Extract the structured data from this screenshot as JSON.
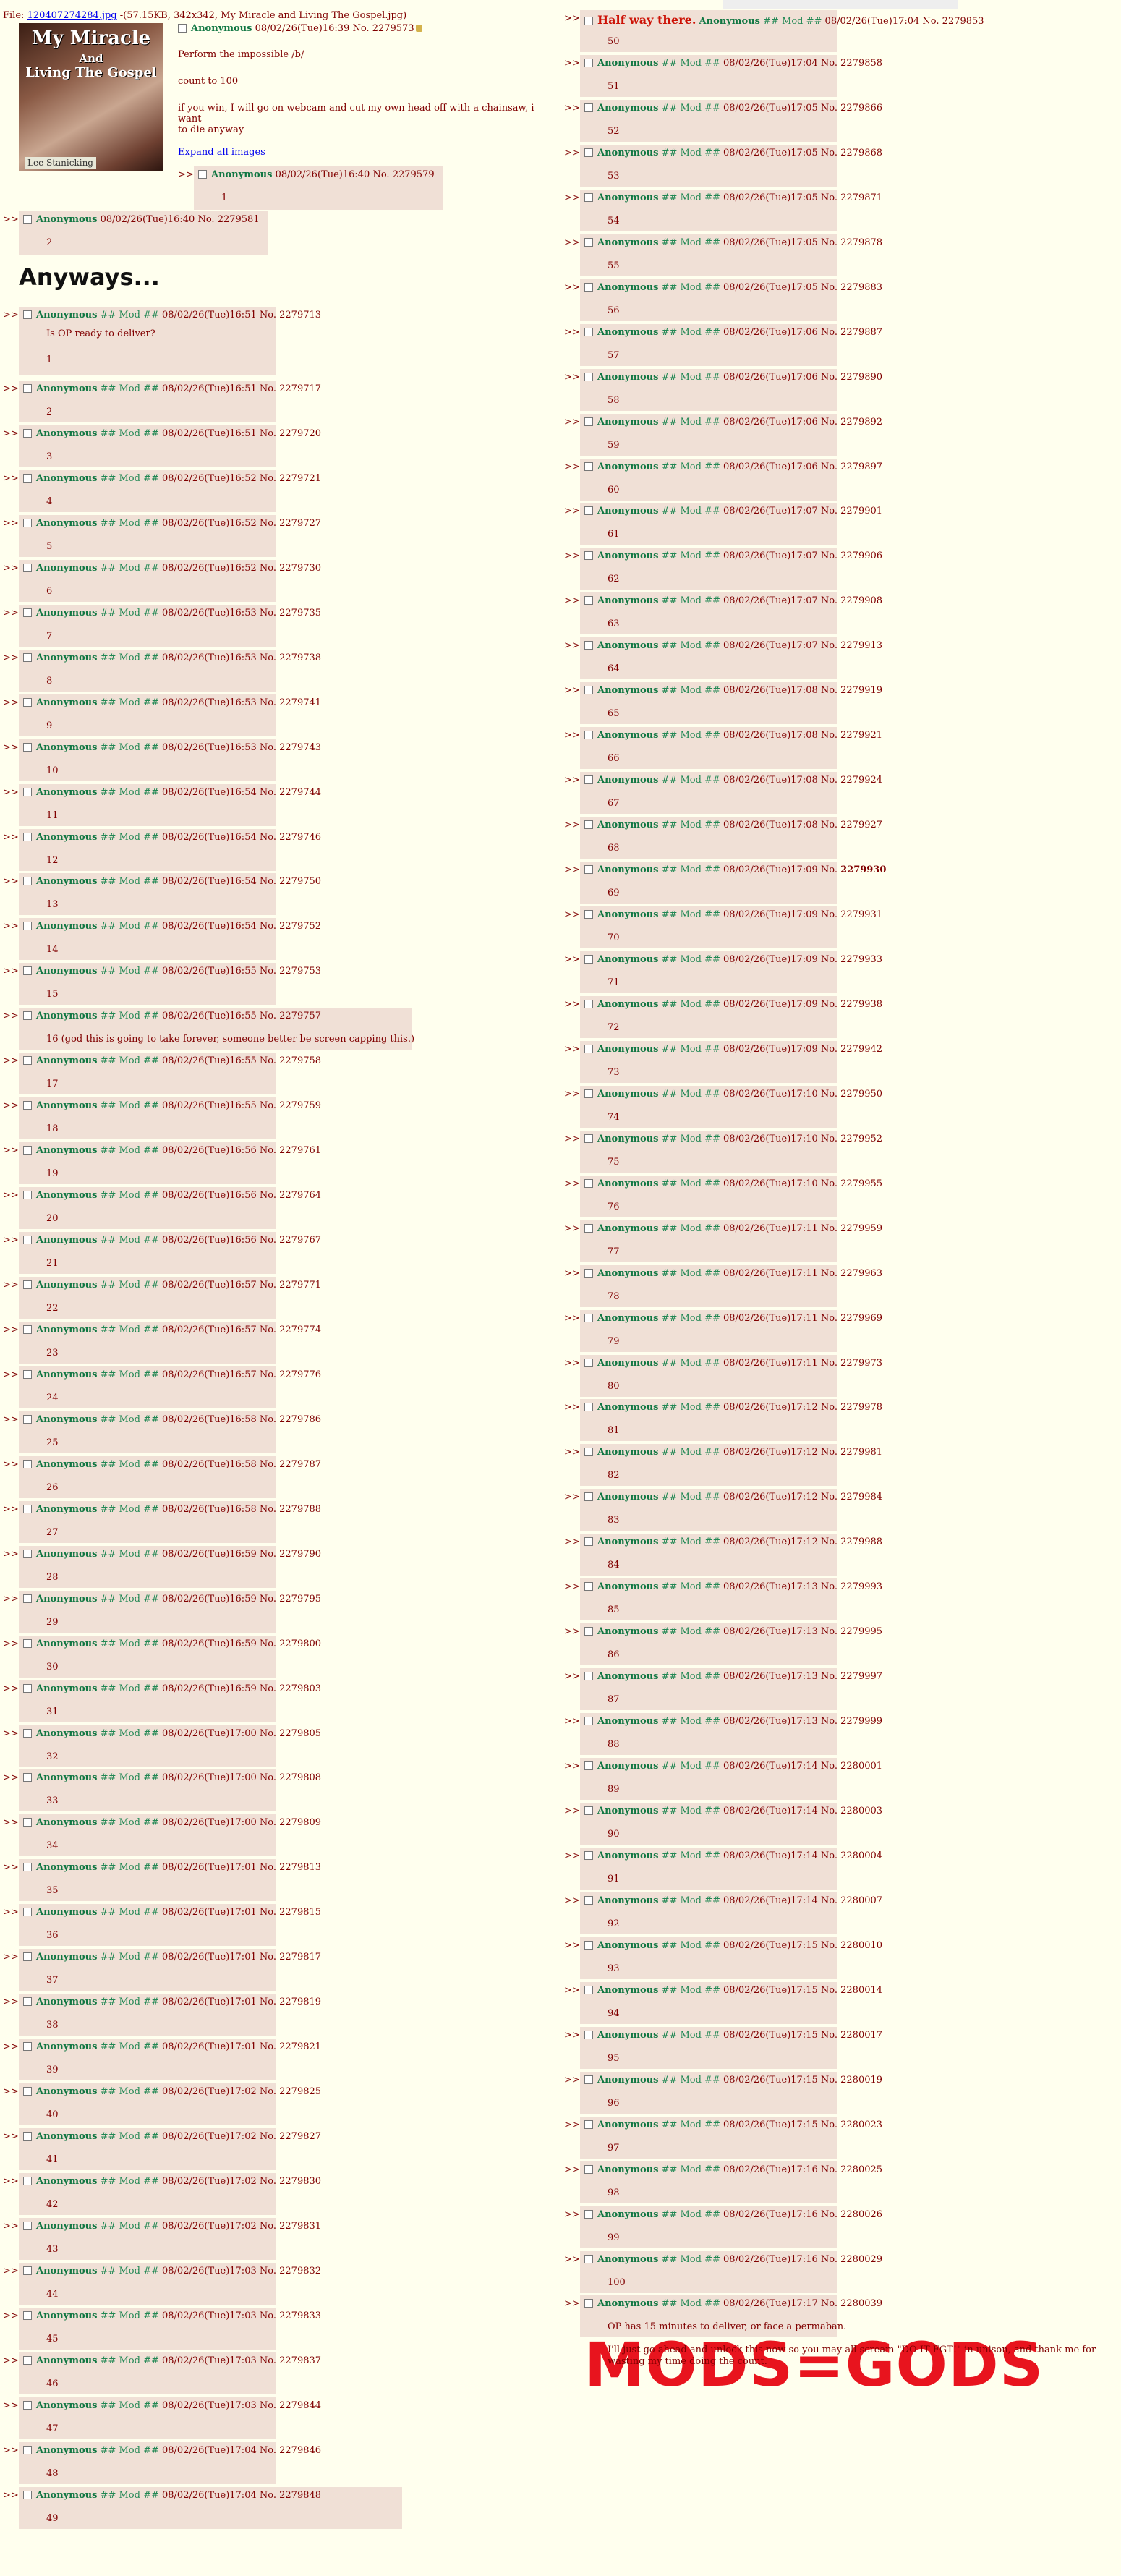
{
  "file": {
    "prefix": "File:",
    "link": "120407274284.jpg",
    "meta": "-(57.15KB, 342x342, My Miracle and Living The Gospel.jpg)"
  },
  "thumbnail": {
    "title_line1": "My Miracle",
    "title_line2": "And",
    "title_line3": "Living The Gospel",
    "caption": "Lee Stanicking"
  },
  "op": {
    "name": "Anonymous",
    "date": "08/02/26(Tue)16:39",
    "no_label": "No.",
    "no": "2279573",
    "line1": "Perform the impossible /b/",
    "line2": "count to 100",
    "line3": "if you win, I will go on webcam and cut my own head off with a chainsaw, i want",
    "line4": "to die anyway",
    "expand": "Expand all images"
  },
  "heading": "Anyways...",
  "mods_banner": "MODS=GODS",
  "reply_arrows": ">>",
  "mod_tag": "## Mod ##",
  "posts": [
    {
      "name": "Anonymous",
      "mod": false,
      "date": "08/02/26(Tue)16:40",
      "no": "2279579",
      "body": "1"
    },
    {
      "name": "Anonymous",
      "mod": false,
      "date": "08/02/26(Tue)16:40",
      "no": "2279581",
      "body": "2"
    },
    {
      "name": "Anonymous",
      "mod": true,
      "date": "08/02/26(Tue)16:51",
      "no": "2279713",
      "body": "Is OP ready to deliver?",
      "body2": "1"
    },
    {
      "name": "Anonymous",
      "mod": true,
      "date": "08/02/26(Tue)16:51",
      "no": "2279717",
      "body": "2"
    },
    {
      "name": "Anonymous",
      "mod": true,
      "date": "08/02/26(Tue)16:51",
      "no": "2279720",
      "body": "3"
    },
    {
      "name": "Anonymous",
      "mod": true,
      "date": "08/02/26(Tue)16:52",
      "no": "2279721",
      "body": "4"
    },
    {
      "name": "Anonymous",
      "mod": true,
      "date": "08/02/26(Tue)16:52",
      "no": "2279727",
      "body": "5"
    },
    {
      "name": "Anonymous",
      "mod": true,
      "date": "08/02/26(Tue)16:52",
      "no": "2279730",
      "body": "6"
    },
    {
      "name": "Anonymous",
      "mod": true,
      "date": "08/02/26(Tue)16:53",
      "no": "2279735",
      "body": "7"
    },
    {
      "name": "Anonymous",
      "mod": true,
      "date": "08/02/26(Tue)16:53",
      "no": "2279738",
      "body": "8"
    },
    {
      "name": "Anonymous",
      "mod": true,
      "date": "08/02/26(Tue)16:53",
      "no": "2279741",
      "body": "9"
    },
    {
      "name": "Anonymous",
      "mod": true,
      "date": "08/02/26(Tue)16:53",
      "no": "2279743",
      "body": "10"
    },
    {
      "name": "Anonymous",
      "mod": true,
      "date": "08/02/26(Tue)16:54",
      "no": "2279744",
      "body": "11"
    },
    {
      "name": "Anonymous",
      "mod": true,
      "date": "08/02/26(Tue)16:54",
      "no": "2279746",
      "body": "12"
    },
    {
      "name": "Anonymous",
      "mod": true,
      "date": "08/02/26(Tue)16:54",
      "no": "2279750",
      "body": "13"
    },
    {
      "name": "Anonymous",
      "mod": true,
      "date": "08/02/26(Tue)16:54",
      "no": "2279752",
      "body": "14"
    },
    {
      "name": "Anonymous",
      "mod": true,
      "date": "08/02/26(Tue)16:55",
      "no": "2279753",
      "body": "15"
    },
    {
      "name": "Anonymous",
      "mod": true,
      "date": "08/02/26(Tue)16:55",
      "no": "2279757",
      "body": "16 (god this is going to take forever, someone better be screen capping this.)"
    },
    {
      "name": "Anonymous",
      "mod": true,
      "date": "08/02/26(Tue)16:55",
      "no": "2279758",
      "body": "17"
    },
    {
      "name": "Anonymous",
      "mod": true,
      "date": "08/02/26(Tue)16:55",
      "no": "2279759",
      "body": "18"
    },
    {
      "name": "Anonymous",
      "mod": true,
      "date": "08/02/26(Tue)16:56",
      "no": "2279761",
      "body": "19"
    },
    {
      "name": "Anonymous",
      "mod": true,
      "date": "08/02/26(Tue)16:56",
      "no": "2279764",
      "body": "20"
    },
    {
      "name": "Anonymous",
      "mod": true,
      "date": "08/02/26(Tue)16:56",
      "no": "2279767",
      "body": "21"
    },
    {
      "name": "Anonymous",
      "mod": true,
      "date": "08/02/26(Tue)16:57",
      "no": "2279771",
      "body": "22"
    },
    {
      "name": "Anonymous",
      "mod": true,
      "date": "08/02/26(Tue)16:57",
      "no": "2279774",
      "body": "23"
    },
    {
      "name": "Anonymous",
      "mod": true,
      "date": "08/02/26(Tue)16:57",
      "no": "2279776",
      "body": "24"
    },
    {
      "name": "Anonymous",
      "mod": true,
      "date": "08/02/26(Tue)16:58",
      "no": "2279786",
      "body": "25"
    },
    {
      "name": "Anonymous",
      "mod": true,
      "date": "08/02/26(Tue)16:58",
      "no": "2279787",
      "body": "26"
    },
    {
      "name": "Anonymous",
      "mod": true,
      "date": "08/02/26(Tue)16:58",
      "no": "2279788",
      "body": "27"
    },
    {
      "name": "Anonymous",
      "mod": true,
      "date": "08/02/26(Tue)16:59",
      "no": "2279790",
      "body": "28"
    },
    {
      "name": "Anonymous",
      "mod": true,
      "date": "08/02/26(Tue)16:59",
      "no": "2279795",
      "body": "29"
    },
    {
      "name": "Anonymous",
      "mod": true,
      "date": "08/02/26(Tue)16:59",
      "no": "2279800",
      "body": "30"
    },
    {
      "name": "Anonymous",
      "mod": true,
      "date": "08/02/26(Tue)16:59",
      "no": "2279803",
      "body": "31"
    },
    {
      "name": "Anonymous",
      "mod": true,
      "date": "08/02/26(Tue)17:00",
      "no": "2279805",
      "body": "32"
    },
    {
      "name": "Anonymous",
      "mod": true,
      "date": "08/02/26(Tue)17:00",
      "no": "2279808",
      "body": "33"
    },
    {
      "name": "Anonymous",
      "mod": true,
      "date": "08/02/26(Tue)17:00",
      "no": "2279809",
      "body": "34"
    },
    {
      "name": "Anonymous",
      "mod": true,
      "date": "08/02/26(Tue)17:01",
      "no": "2279813",
      "body": "35"
    },
    {
      "name": "Anonymous",
      "mod": true,
      "date": "08/02/26(Tue)17:01",
      "no": "2279815",
      "body": "36"
    },
    {
      "name": "Anonymous",
      "mod": true,
      "date": "08/02/26(Tue)17:01",
      "no": "2279817",
      "body": "37"
    },
    {
      "name": "Anonymous",
      "mod": true,
      "date": "08/02/26(Tue)17:01",
      "no": "2279819",
      "body": "38"
    },
    {
      "name": "Anonymous",
      "mod": true,
      "date": "08/02/26(Tue)17:01",
      "no": "2279821",
      "body": "39"
    },
    {
      "name": "Anonymous",
      "mod": true,
      "date": "08/02/26(Tue)17:02",
      "no": "2279825",
      "body": "40"
    },
    {
      "name": "Anonymous",
      "mod": true,
      "date": "08/02/26(Tue)17:02",
      "no": "2279827",
      "body": "41"
    },
    {
      "name": "Anonymous",
      "mod": true,
      "date": "08/02/26(Tue)17:02",
      "no": "2279830",
      "body": "42"
    },
    {
      "name": "Anonymous",
      "mod": true,
      "date": "08/02/26(Tue)17:02",
      "no": "2279831",
      "body": "43"
    },
    {
      "name": "Anonymous",
      "mod": true,
      "date": "08/02/26(Tue)17:03",
      "no": "2279832",
      "body": "44"
    },
    {
      "name": "Anonymous",
      "mod": true,
      "date": "08/02/26(Tue)17:03",
      "no": "2279833",
      "body": "45"
    },
    {
      "name": "Anonymous",
      "mod": true,
      "date": "08/02/26(Tue)17:03",
      "no": "2279837",
      "body": "46"
    },
    {
      "name": "Anonymous",
      "mod": true,
      "date": "08/02/26(Tue)17:03",
      "no": "2279844",
      "body": "47"
    },
    {
      "name": "Anonymous",
      "mod": true,
      "date": "08/02/26(Tue)17:04",
      "no": "2279846",
      "body": "48"
    },
    {
      "name": "Anonymous",
      "mod": true,
      "date": "08/02/26(Tue)17:04",
      "no": "2279848",
      "body": "49"
    },
    {
      "name": "Anonymous",
      "mod": true,
      "subject": "Half way there.",
      "date": "08/02/26(Tue)17:04",
      "no": "2279853",
      "body": "50"
    },
    {
      "name": "Anonymous",
      "mod": true,
      "date": "08/02/26(Tue)17:04",
      "no": "2279858",
      "body": "51"
    },
    {
      "name": "Anonymous",
      "mod": true,
      "date": "08/02/26(Tue)17:05",
      "no": "2279866",
      "body": "52"
    },
    {
      "name": "Anonymous",
      "mod": true,
      "date": "08/02/26(Tue)17:05",
      "no": "2279868",
      "body": "53"
    },
    {
      "name": "Anonymous",
      "mod": true,
      "date": "08/02/26(Tue)17:05",
      "no": "2279871",
      "body": "54"
    },
    {
      "name": "Anonymous",
      "mod": true,
      "date": "08/02/26(Tue)17:05",
      "no": "2279878",
      "body": "55"
    },
    {
      "name": "Anonymous",
      "mod": true,
      "date": "08/02/26(Tue)17:05",
      "no": "2279883",
      "body": "56"
    },
    {
      "name": "Anonymous",
      "mod": true,
      "date": "08/02/26(Tue)17:06",
      "no": "2279887",
      "body": "57"
    },
    {
      "name": "Anonymous",
      "mod": true,
      "date": "08/02/26(Tue)17:06",
      "no": "2279890",
      "body": "58"
    },
    {
      "name": "Anonymous",
      "mod": true,
      "date": "08/02/26(Tue)17:06",
      "no": "2279892",
      "body": "59"
    },
    {
      "name": "Anonymous",
      "mod": true,
      "date": "08/02/26(Tue)17:06",
      "no": "2279897",
      "body": "60"
    },
    {
      "name": "Anonymous",
      "mod": true,
      "date": "08/02/26(Tue)17:07",
      "no": "2279901",
      "body": "61"
    },
    {
      "name": "Anonymous",
      "mod": true,
      "date": "08/02/26(Tue)17:07",
      "no": "2279906",
      "body": "62"
    },
    {
      "name": "Anonymous",
      "mod": true,
      "date": "08/02/26(Tue)17:07",
      "no": "2279908",
      "body": "63"
    },
    {
      "name": "Anonymous",
      "mod": true,
      "date": "08/02/26(Tue)17:07",
      "no": "2279913",
      "body": "64"
    },
    {
      "name": "Anonymous",
      "mod": true,
      "date": "08/02/26(Tue)17:08",
      "no": "2279919",
      "body": "65"
    },
    {
      "name": "Anonymous",
      "mod": true,
      "date": "08/02/26(Tue)17:08",
      "no": "2279921",
      "body": "66"
    },
    {
      "name": "Anonymous",
      "mod": true,
      "date": "08/02/26(Tue)17:08",
      "no": "2279924",
      "body": "67"
    },
    {
      "name": "Anonymous",
      "mod": true,
      "date": "08/02/26(Tue)17:08",
      "no": "2279927",
      "body": "68"
    },
    {
      "name": "Anonymous",
      "mod": true,
      "date": "08/02/26(Tue)17:09",
      "no": "2279930",
      "bold_no": true,
      "body": "69"
    },
    {
      "name": "Anonymous",
      "mod": true,
      "date": "08/02/26(Tue)17:09",
      "no": "2279931",
      "body": "70"
    },
    {
      "name": "Anonymous",
      "mod": true,
      "date": "08/02/26(Tue)17:09",
      "no": "2279933",
      "body": "71"
    },
    {
      "name": "Anonymous",
      "mod": true,
      "date": "08/02/26(Tue)17:09",
      "no": "2279938",
      "body": "72"
    },
    {
      "name": "Anonymous",
      "mod": true,
      "date": "08/02/26(Tue)17:09",
      "no": "2279942",
      "body": "73"
    },
    {
      "name": "Anonymous",
      "mod": true,
      "date": "08/02/26(Tue)17:10",
      "no": "2279950",
      "body": "74"
    },
    {
      "name": "Anonymous",
      "mod": true,
      "date": "08/02/26(Tue)17:10",
      "no": "2279952",
      "body": "75"
    },
    {
      "name": "Anonymous",
      "mod": true,
      "date": "08/02/26(Tue)17:10",
      "no": "2279955",
      "body": "76"
    },
    {
      "name": "Anonymous",
      "mod": true,
      "date": "08/02/26(Tue)17:11",
      "no": "2279959",
      "body": "77"
    },
    {
      "name": "Anonymous",
      "mod": true,
      "date": "08/02/26(Tue)17:11",
      "no": "2279963",
      "body": "78"
    },
    {
      "name": "Anonymous",
      "mod": true,
      "date": "08/02/26(Tue)17:11",
      "no": "2279969",
      "body": "79"
    },
    {
      "name": "Anonymous",
      "mod": true,
      "date": "08/02/26(Tue)17:11",
      "no": "2279973",
      "body": "80"
    },
    {
      "name": "Anonymous",
      "mod": true,
      "date": "08/02/26(Tue)17:12",
      "no": "2279978",
      "body": "81"
    },
    {
      "name": "Anonymous",
      "mod": true,
      "date": "08/02/26(Tue)17:12",
      "no": "2279981",
      "body": "82"
    },
    {
      "name": "Anonymous",
      "mod": true,
      "date": "08/02/26(Tue)17:12",
      "no": "2279984",
      "body": "83"
    },
    {
      "name": "Anonymous",
      "mod": true,
      "date": "08/02/26(Tue)17:12",
      "no": "2279988",
      "body": "84"
    },
    {
      "name": "Anonymous",
      "mod": true,
      "date": "08/02/26(Tue)17:13",
      "no": "2279993",
      "body": "85"
    },
    {
      "name": "Anonymous",
      "mod": true,
      "date": "08/02/26(Tue)17:13",
      "no": "2279995",
      "body": "86"
    },
    {
      "name": "Anonymous",
      "mod": true,
      "date": "08/02/26(Tue)17:13",
      "no": "2279997",
      "body": "87"
    },
    {
      "name": "Anonymous",
      "mod": true,
      "date": "08/02/26(Tue)17:13",
      "no": "2279999",
      "body": "88"
    },
    {
      "name": "Anonymous",
      "mod": true,
      "date": "08/02/26(Tue)17:14",
      "no": "2280001",
      "body": "89"
    },
    {
      "name": "Anonymous",
      "mod": true,
      "date": "08/02/26(Tue)17:14",
      "no": "2280003",
      "body": "90"
    },
    {
      "name": "Anonymous",
      "mod": true,
      "date": "08/02/26(Tue)17:14",
      "no": "2280004",
      "body": "91"
    },
    {
      "name": "Anonymous",
      "mod": true,
      "date": "08/02/26(Tue)17:14",
      "no": "2280007",
      "body": "92"
    },
    {
      "name": "Anonymous",
      "mod": true,
      "date": "08/02/26(Tue)17:15",
      "no": "2280010",
      "body": "93"
    },
    {
      "name": "Anonymous",
      "mod": true,
      "date": "08/02/26(Tue)17:15",
      "no": "2280014",
      "body": "94"
    },
    {
      "name": "Anonymous",
      "mod": true,
      "date": "08/02/26(Tue)17:15",
      "no": "2280017",
      "body": "95"
    },
    {
      "name": "Anonymous",
      "mod": true,
      "date": "08/02/26(Tue)17:15",
      "no": "2280019",
      "body": "96"
    },
    {
      "name": "Anonymous",
      "mod": true,
      "date": "08/02/26(Tue)17:15",
      "no": "2280023",
      "body": "97"
    },
    {
      "name": "Anonymous",
      "mod": true,
      "date": "08/02/26(Tue)17:16",
      "no": "2280025",
      "body": "98"
    },
    {
      "name": "Anonymous",
      "mod": true,
      "date": "08/02/26(Tue)17:16",
      "no": "2280026",
      "body": "99"
    },
    {
      "name": "Anonymous",
      "mod": true,
      "date": "08/02/26(Tue)17:16",
      "no": "2280029",
      "body": "100"
    },
    {
      "name": "Anonymous",
      "mod": true,
      "date": "08/02/26(Tue)17:17",
      "no": "2280039",
      "body": "OP has 15 minutes to deliver, or face a permaban.",
      "body2": "I'll just go ahead and unlock this now so you may all scream \"DO IT FGT!\" in unison, and thank me for",
      "body3": "wasting my time doing the count."
    }
  ]
}
